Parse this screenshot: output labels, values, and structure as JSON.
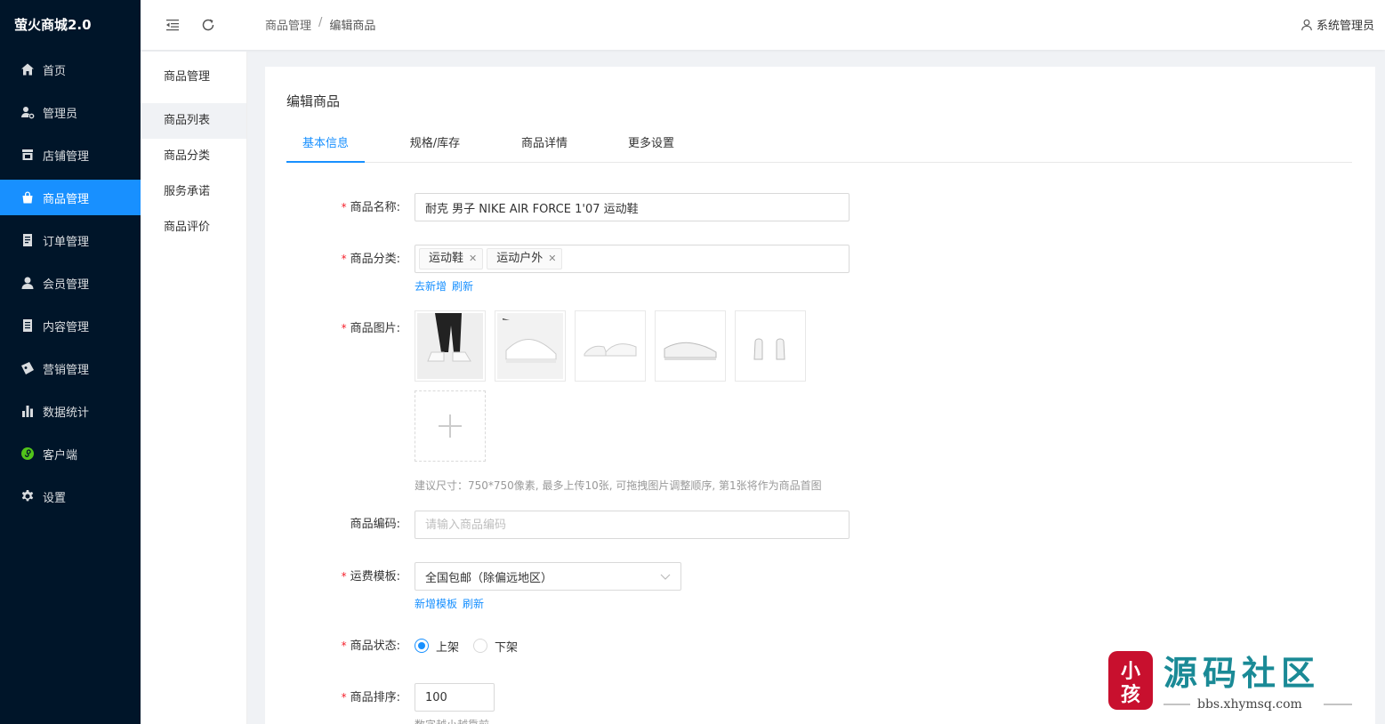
{
  "brand": "萤火商城2.0",
  "sidebar": {
    "items": [
      {
        "label": "首页",
        "icon": "home-icon"
      },
      {
        "label": "管理员",
        "icon": "admin-icon"
      },
      {
        "label": "店铺管理",
        "icon": "shop-icon"
      },
      {
        "label": "商品管理",
        "icon": "bag-icon",
        "active": true
      },
      {
        "label": "订单管理",
        "icon": "order-icon"
      },
      {
        "label": "会员管理",
        "icon": "user-icon"
      },
      {
        "label": "内容管理",
        "icon": "content-icon"
      },
      {
        "label": "营销管理",
        "icon": "marketing-icon"
      },
      {
        "label": "数据统计",
        "icon": "chart-icon"
      },
      {
        "label": "客户端",
        "icon": "client-icon"
      },
      {
        "label": "设置",
        "icon": "gear-icon"
      }
    ]
  },
  "submenu": {
    "title": "商品管理",
    "items": [
      "商品列表",
      "商品分类",
      "服务承诺",
      "商品评价"
    ]
  },
  "header": {
    "breadcrumb": [
      "商品管理",
      "编辑商品"
    ],
    "separator": "/",
    "user": "系统管理员"
  },
  "card": {
    "title": "编辑商品",
    "tabs": [
      "基本信息",
      "规格/库存",
      "商品详情",
      "更多设置"
    ]
  },
  "form": {
    "name": {
      "label": "商品名称:",
      "value": "耐克 男子 NIKE AIR FORCE 1'07 运动鞋"
    },
    "category": {
      "label": "商品分类:",
      "tags": [
        "运动鞋",
        "运动户外"
      ],
      "links": [
        "去新增",
        "刷新"
      ]
    },
    "images": {
      "label": "商品图片:",
      "hint": "建议尺寸：750*750像素, 最多上传10张, 可拖拽图片调整顺序, 第1张将作为商品首图"
    },
    "code": {
      "label": "商品编码:",
      "placeholder": "请输入商品编码"
    },
    "shipping": {
      "label": "运费模板:",
      "value": "全国包邮（除偏远地区）",
      "links": [
        "新增模板",
        "刷新"
      ]
    },
    "status": {
      "label": "商品状态:",
      "options": [
        "上架",
        "下架"
      ],
      "selected": "上架"
    },
    "sort": {
      "label": "商品排序:",
      "value": "100",
      "hint": "数字越小越靠前"
    }
  },
  "colors": {
    "accent": "#1890ff",
    "sidebar": "#001529",
    "required": "#f5222d"
  }
}
